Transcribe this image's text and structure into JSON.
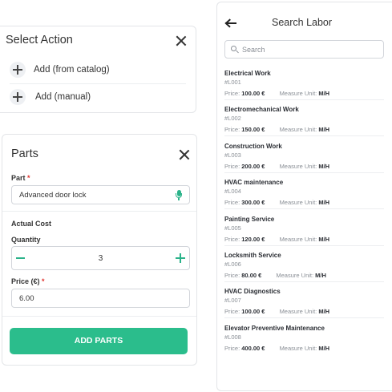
{
  "select_action": {
    "title": "Select Action",
    "items": [
      {
        "label": "Add (from catalog)"
      },
      {
        "label": "Add (manual)"
      }
    ]
  },
  "parts": {
    "title": "Parts",
    "part_label": "Part",
    "required_mark": "*",
    "part_value": "Advanced door lock",
    "actual_cost_heading": "Actual Cost",
    "quantity_label": "Quantity",
    "quantity_value": "3",
    "price_label": "Price (€)",
    "price_value": "6.00",
    "submit_label": "ADD PARTS"
  },
  "labor": {
    "title": "Search Labor",
    "search_placeholder": "Search",
    "price_label": "Price:",
    "unit_label": "Measure Unit:",
    "items": [
      {
        "name": "Electrical Work",
        "code": "#L001",
        "price": "100.00 €",
        "unit": "M/H"
      },
      {
        "name": "Electromechanical Work",
        "code": "#L002",
        "price": "150.00 €",
        "unit": "M/H"
      },
      {
        "name": "Construction Work",
        "code": "#L003",
        "price": "200.00 €",
        "unit": "M/H"
      },
      {
        "name": "HVAC maintenance",
        "code": "#L004",
        "price": "300.00 €",
        "unit": "M/H"
      },
      {
        "name": "Painting Service",
        "code": "#L005",
        "price": "120.00 €",
        "unit": "M/H"
      },
      {
        "name": "Locksmith Service",
        "code": "#L006",
        "price": "80.00 €",
        "unit": "M/H"
      },
      {
        "name": "HVAC Diagnostics",
        "code": "#L007",
        "price": "100.00 €",
        "unit": "M/H"
      },
      {
        "name": "Elevator Preventive Maintenance",
        "code": "#L008",
        "price": "400.00 €",
        "unit": "M/H"
      }
    ]
  },
  "colors": {
    "accent": "#2bbd8c",
    "required": "#e0342f",
    "muted_text": "#8a8f96"
  }
}
